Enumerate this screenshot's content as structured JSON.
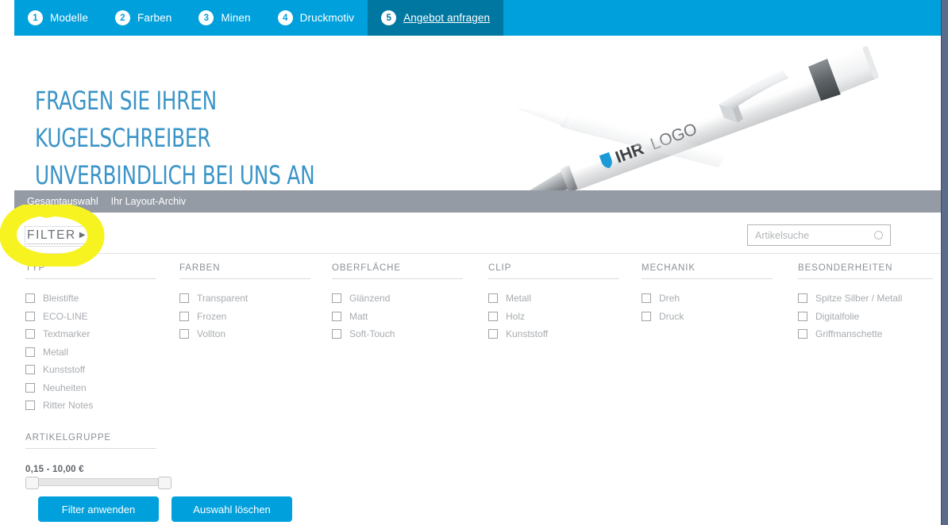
{
  "steps": [
    {
      "num": "1",
      "label": "Modelle",
      "active": false
    },
    {
      "num": "2",
      "label": "Farben",
      "active": false
    },
    {
      "num": "3",
      "label": "Minen",
      "active": false
    },
    {
      "num": "4",
      "label": "Druckmotiv",
      "active": false
    },
    {
      "num": "5",
      "label": "Angebot anfragen",
      "active": true
    }
  ],
  "hero": {
    "title": "FRAGEN SIE IHREN KUGELSCHREIBER\nUNVERBINDLICH BEI UNS AN",
    "pen_logo_text": "IHR LOGO"
  },
  "subnav": {
    "items": [
      {
        "label": "Gesamtauswahl"
      },
      {
        "label": "Ihr Layout-Archiv"
      }
    ]
  },
  "filterbar": {
    "toggle_label": "FILTER",
    "toggle_caret": "▶"
  },
  "search": {
    "placeholder": "Artikelsuche",
    "value": ""
  },
  "filters": {
    "columns": [
      {
        "title": "TYP",
        "options": [
          {
            "label": "Bleistifte",
            "checked": false
          },
          {
            "label": "ECO-LINE",
            "checked": false
          },
          {
            "label": "Textmarker",
            "checked": false
          },
          {
            "label": "Metall",
            "checked": false
          },
          {
            "label": "Kunststoff",
            "checked": false
          },
          {
            "label": "Neuheiten",
            "checked": false
          },
          {
            "label": "Ritter Notes",
            "checked": false
          }
        ]
      },
      {
        "title": "FARBEN",
        "options": [
          {
            "label": "Transparent",
            "checked": false
          },
          {
            "label": "Frozen",
            "checked": false
          },
          {
            "label": "Vollton",
            "checked": false
          }
        ]
      },
      {
        "title": "OBERFLÄCHE",
        "options": [
          {
            "label": "Glänzend",
            "checked": false
          },
          {
            "label": "Matt",
            "checked": false
          },
          {
            "label": "Soft-Touch",
            "checked": false
          }
        ]
      },
      {
        "title": "CLIP",
        "options": [
          {
            "label": "Metall",
            "checked": false
          },
          {
            "label": "Holz",
            "checked": false
          },
          {
            "label": "Kunststoff",
            "checked": false
          }
        ]
      },
      {
        "title": "MECHANIK",
        "options": [
          {
            "label": "Dreh",
            "checked": false
          },
          {
            "label": "Druck",
            "checked": false
          }
        ]
      },
      {
        "title": "BESONDERHEITEN",
        "options": [
          {
            "label": "Spitze Silber / Metall",
            "checked": false
          },
          {
            "label": "Digitalfolie",
            "checked": false
          },
          {
            "label": "Griffmanschette",
            "checked": false
          }
        ]
      }
    ],
    "artikelgruppe_title": "ARTIKELGRUPPE",
    "price_range_label": "0,15 - 10,00 €",
    "price_min": "0,15",
    "price_max": "10,00",
    "currency": "€",
    "apply_label": "Filter anwenden",
    "clear_label": "Auswahl löschen"
  },
  "annotation": {
    "type": "yellow-highlighter-circle",
    "target": "FILTER",
    "color": "#f7f320"
  },
  "colors": {
    "brand_cyan": "#00a0dc",
    "active_tab": "#0077a0",
    "subnav_gray": "#949ba4",
    "heading_blue": "#3a94c8",
    "label_gray": "#a8acb0",
    "highlight_yellow": "#f7f320"
  }
}
